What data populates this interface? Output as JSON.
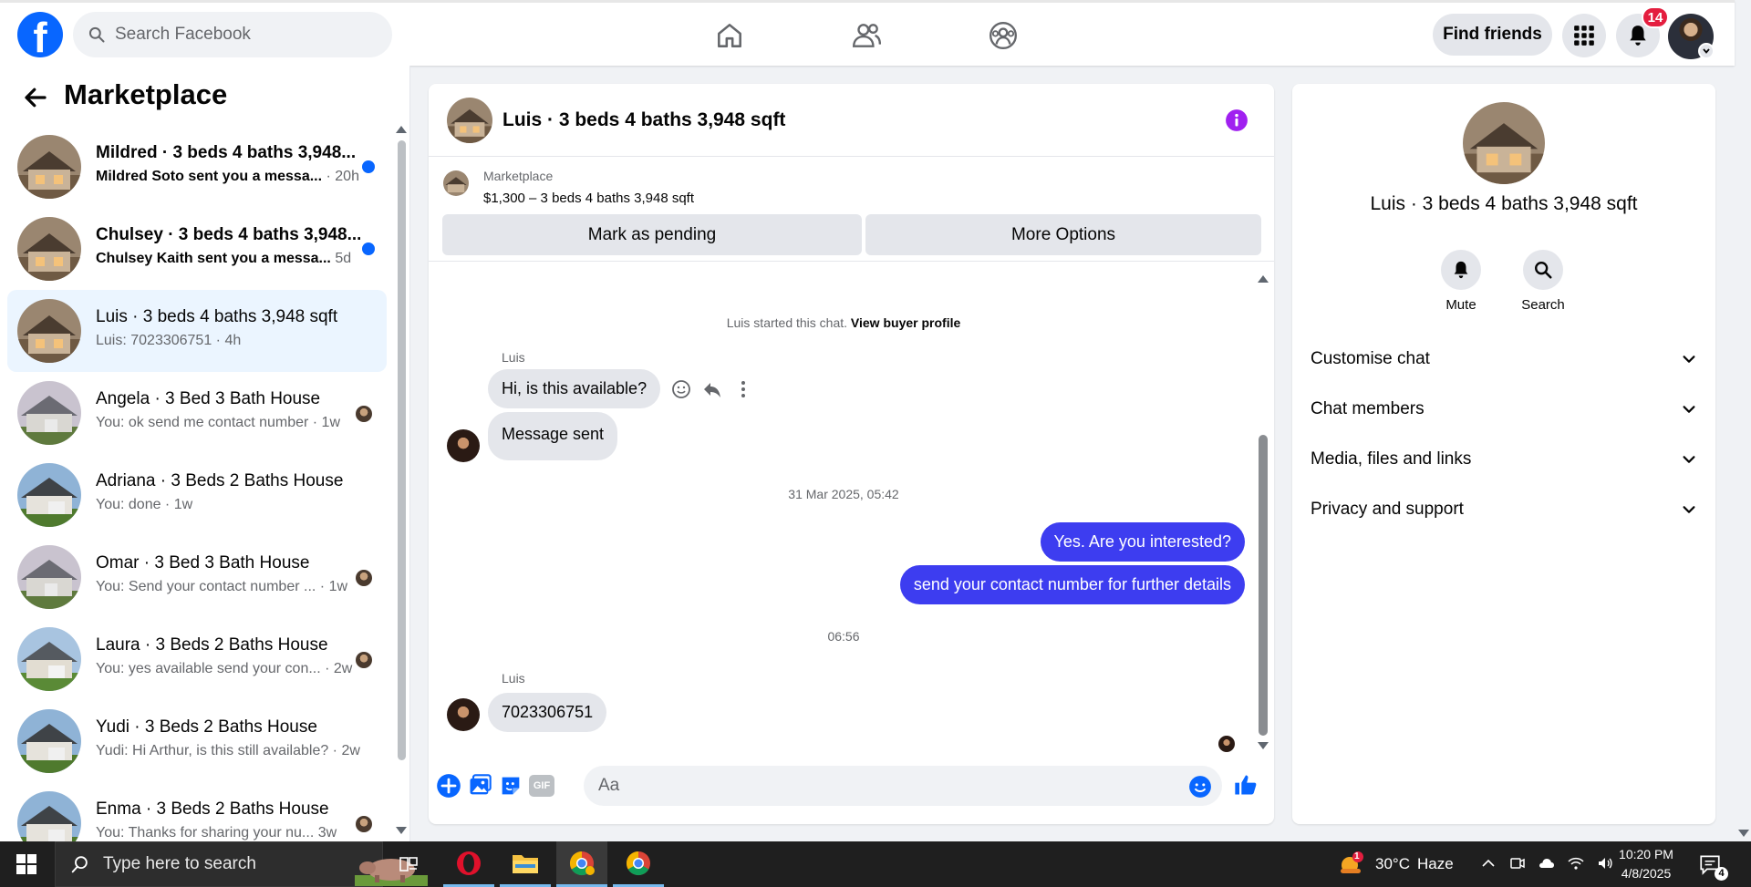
{
  "topbar": {
    "logo": "f",
    "search_placeholder": "Search Facebook",
    "find_friends": "Find friends",
    "notification_count": "14"
  },
  "left": {
    "title": "Marketplace",
    "conversations": [
      {
        "title": "Mildred · 3 beds 4 baths 3,948...",
        "preview": "Mildred Soto sent you a messa...",
        "time": "20h",
        "unread": true
      },
      {
        "title": "Chulsey · 3 beds 4 baths 3,948...",
        "preview": "Chulsey Kaith sent you a messa...",
        "time": "5d",
        "unread": true
      },
      {
        "title": "Luis · 3 beds 4 baths 3,948 sqft",
        "preview": "Luis: 7023306751",
        "time": "4h",
        "active": true
      },
      {
        "title": "Angela · 3 Bed 3 Bath House",
        "preview": "You: ok send me contact number",
        "time": "1w"
      },
      {
        "title": "Adriana · 3 Beds 2 Baths House",
        "preview": "You: done",
        "time": "1w"
      },
      {
        "title": "Omar · 3 Bed 3 Bath House",
        "preview": "You: Send your contact number ...",
        "time": "1w"
      },
      {
        "title": "Laura · 3 Beds 2 Baths House",
        "preview": "You: yes available send your con...",
        "time": "2w"
      },
      {
        "title": "Yudi · 3 Beds 2 Baths House",
        "preview": "Yudi: Hi Arthur, is this still available?",
        "time": "2w"
      },
      {
        "title": "Enma · 3 Beds 2 Baths House",
        "preview": "You: Thanks for sharing your nu...",
        "time": "3w"
      }
    ]
  },
  "chat": {
    "title": "Luis · 3 beds 4 baths 3,948 sqft",
    "listing_source": "Marketplace",
    "listing_price": "$1,300 – 3 beds 4 baths 3,948 sqft",
    "btn_pending": "Mark as pending",
    "btn_more": "More Options",
    "started_note": "Luis started this chat.",
    "view_profile": "View buyer profile",
    "sender1": "Luis",
    "msg1": "Hi, is this available?",
    "msg2": "Message sent",
    "date1": "31 Mar 2025, 05:42",
    "out1": "Yes. Are you interested?",
    "out2": "send your contact number for further details",
    "time2": "06:56",
    "sender2": "Luis",
    "msg3": "7023306751",
    "composer_placeholder": "Aa",
    "gif_label": "GIF"
  },
  "right": {
    "title": "Luis · 3 beds 4 baths 3,948 sqft",
    "mute": "Mute",
    "search": "Search",
    "rows": [
      "Customise chat",
      "Chat members",
      "Media, files and links",
      "Privacy and support"
    ]
  },
  "taskbar": {
    "search_placeholder": "Type here to search",
    "temperature": "30°C",
    "condition": "Haze",
    "time": "10:20 PM",
    "date": "4/8/2025",
    "notif_count": "4",
    "weather_badge": "1"
  },
  "colors": {
    "brand": "#0866ff",
    "outgoing_bubble": "#3d3df0",
    "active_row": "#ebf5ff",
    "badge": "#e41e3f",
    "info": "#a020f0"
  }
}
